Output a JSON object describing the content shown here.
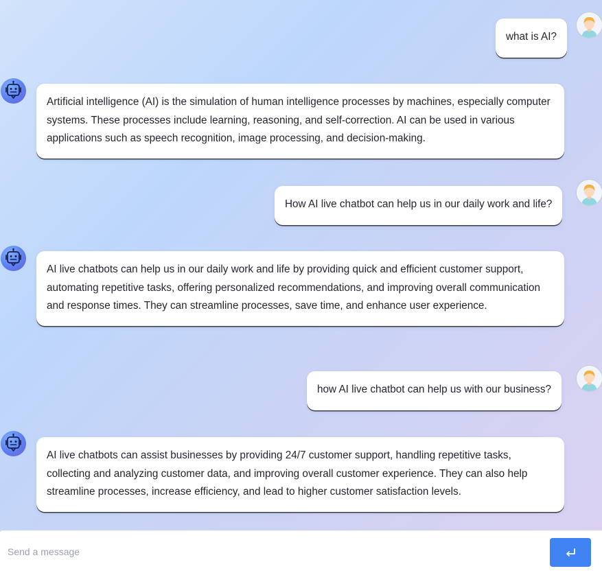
{
  "conversation": {
    "messages": [
      {
        "role": "user",
        "text": "what is AI?"
      },
      {
        "role": "bot",
        "text": "Artificial intelligence (AI) is the simulation of human intelligence processes by machines, especially computer systems. These processes include learning, reasoning, and self-correction. AI can be used in various applications such as speech recognition, image processing, and decision-making."
      },
      {
        "role": "user",
        "text": "How AI live chatbot can help us in our daily work and life?"
      },
      {
        "role": "bot",
        "text": "AI live chatbots can help us in our daily work and life by providing quick and efficient customer support, automating repetitive tasks, offering personalized recommendations, and improving overall communication and response times. They can streamline processes, save time, and enhance user experience."
      },
      {
        "role": "user",
        "text": "how AI live chatbot can help us with our business?"
      },
      {
        "role": "bot",
        "text": "AI live chatbots can assist businesses by providing 24/7 customer support, handling repetitive tasks, collecting and analyzing customer data, and improving overall customer experience. They can also help streamline processes, increase efficiency, and lead to higher customer satisfaction levels."
      }
    ]
  },
  "composer": {
    "placeholder": "Send a message",
    "value": "",
    "send_icon": "enter-return-icon"
  },
  "icons": {
    "user_avatar": "user-avatar-icon",
    "bot_avatar": "robot-icon"
  },
  "colors": {
    "send_button": "#3f83f2",
    "bot_avatar": "#5b7ff0",
    "bubble": "#ffffff"
  }
}
